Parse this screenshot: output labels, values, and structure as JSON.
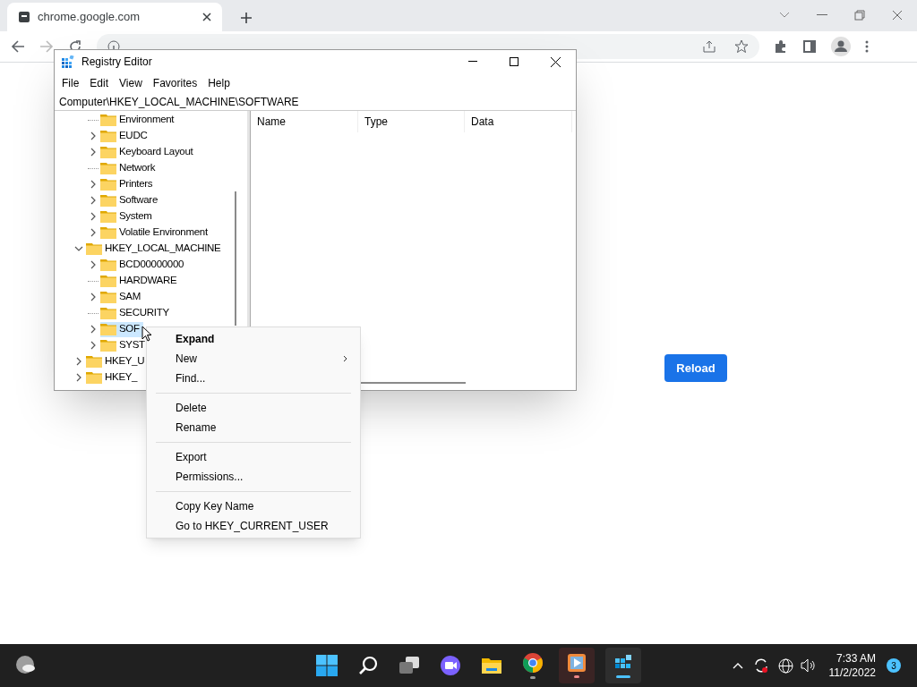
{
  "browser": {
    "tab": {
      "title": "chrome.google.com"
    },
    "page": {
      "button": "Reload"
    }
  },
  "regedit": {
    "title": "Registry Editor",
    "menu": [
      "File",
      "Edit",
      "View",
      "Favorites",
      "Help"
    ],
    "path": "Computer\\HKEY_LOCAL_MACHINE\\SOFTWARE",
    "tree": [
      {
        "children": [
          {
            "label": "Environment",
            "expandable": false,
            "selected": false
          },
          {
            "label": "EUDC",
            "expandable": true,
            "selected": false
          },
          {
            "label": "Keyboard Layout",
            "expandable": true,
            "selected": false
          },
          {
            "label": "Network",
            "expandable": false,
            "selected": false
          },
          {
            "label": "Printers",
            "expandable": true,
            "selected": false
          },
          {
            "label": "Software",
            "expandable": true,
            "selected": false
          },
          {
            "label": "System",
            "expandable": true,
            "selected": false
          },
          {
            "label": "Volatile Environment",
            "expandable": true,
            "selected": false
          }
        ]
      },
      {
        "label": "HKEY_LOCAL_MACHINE",
        "expandable": true,
        "expanded": true,
        "selected": false,
        "children": [
          {
            "label": "BCD00000000",
            "expandable": true,
            "selected": false
          },
          {
            "label": "HARDWARE",
            "expandable": false,
            "selected": false
          },
          {
            "label": "SAM",
            "expandable": true,
            "selected": false
          },
          {
            "label": "SECURITY",
            "expandable": false,
            "selected": false
          },
          {
            "label": "SOF",
            "expandable": true,
            "selected": true
          },
          {
            "label": "SYST",
            "expandable": true,
            "selected": false
          }
        ]
      },
      {
        "label": "HKEY_U",
        "expandable": true,
        "expanded": false,
        "selected": false
      },
      {
        "label": "HKEY_",
        "expandable": true,
        "expanded": false,
        "selected": false
      }
    ],
    "columns": [
      "Name",
      "Type",
      "Data"
    ]
  },
  "context_menu": [
    {
      "kind": "item",
      "label": "Expand",
      "default": true
    },
    {
      "kind": "item",
      "label": "New",
      "submenu": true
    },
    {
      "kind": "item",
      "label": "Find..."
    },
    {
      "kind": "separator"
    },
    {
      "kind": "item",
      "label": "Delete"
    },
    {
      "kind": "item",
      "label": "Rename"
    },
    {
      "kind": "separator"
    },
    {
      "kind": "item",
      "label": "Export"
    },
    {
      "kind": "item",
      "label": "Permissions..."
    },
    {
      "kind": "separator"
    },
    {
      "kind": "item",
      "label": "Copy Key Name"
    },
    {
      "kind": "item",
      "label": "Go to HKEY_CURRENT_USER"
    }
  ],
  "taskbar": {
    "time": "7:33 AM",
    "date": "11/2/2022",
    "notifications": "3"
  }
}
